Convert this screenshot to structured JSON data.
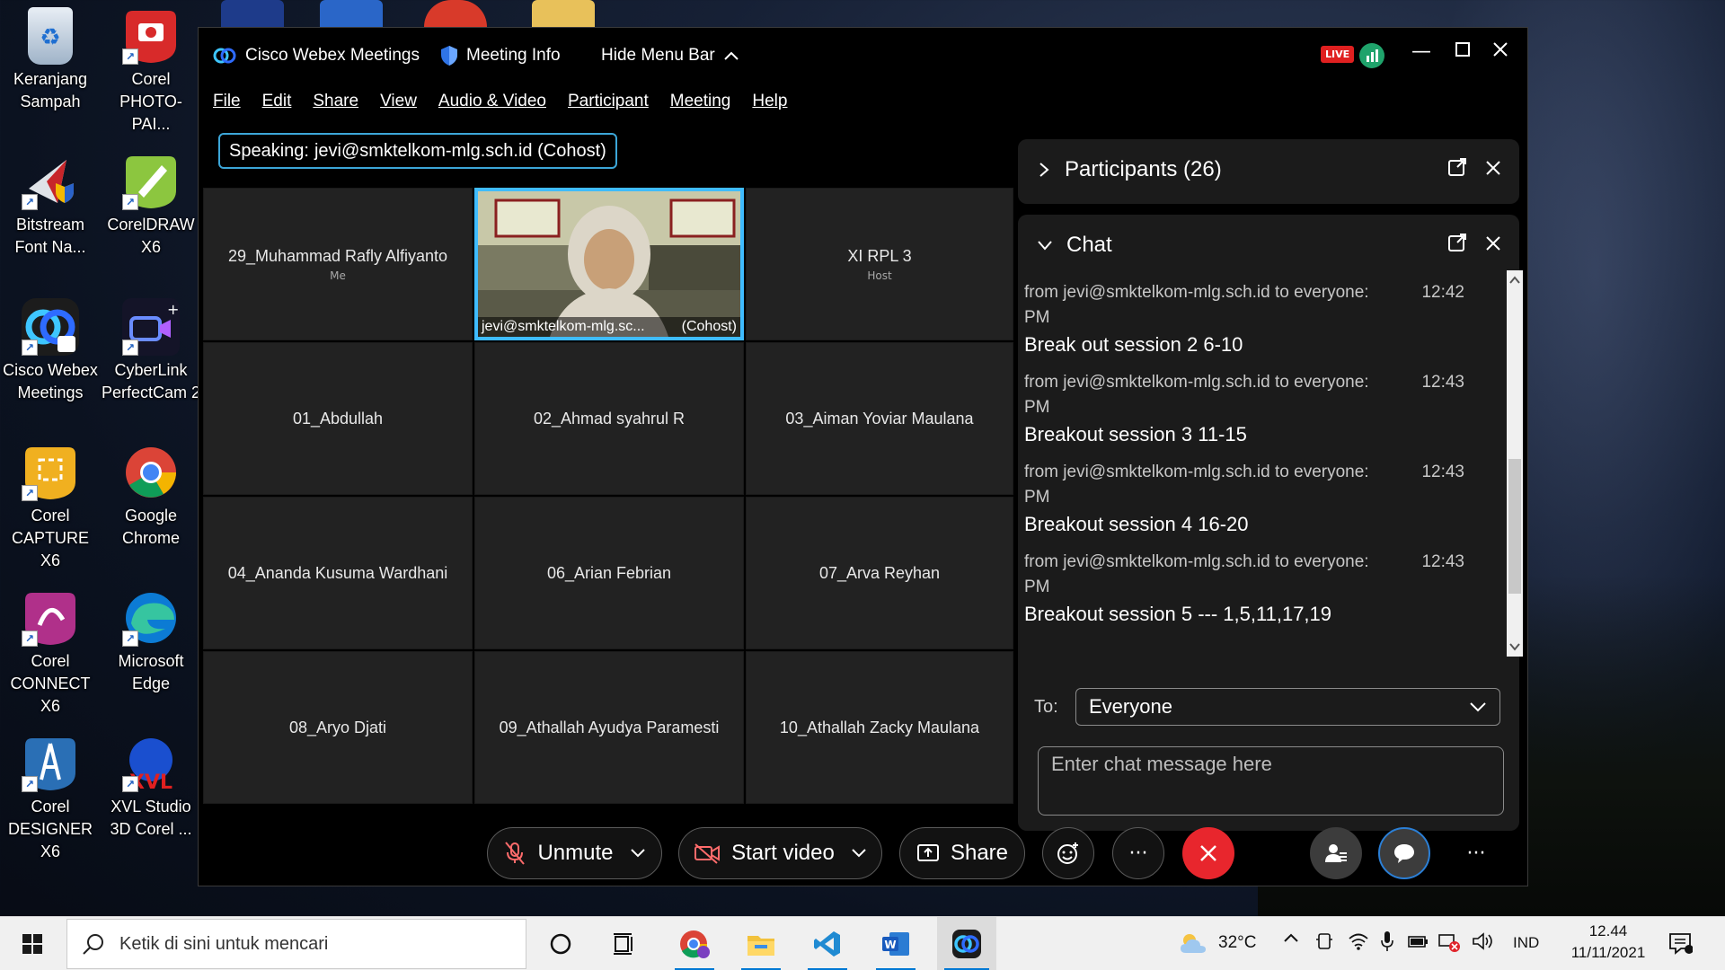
{
  "desktop": {
    "icons": [
      {
        "label": "Keranjang\nSampah"
      },
      {
        "label": "Corel\nPHOTO-PAI..."
      },
      {
        "label": "Bitstream\nFont Na..."
      },
      {
        "label": "CorelDRAW\nX6"
      },
      {
        "label": "Cisco Webex\nMeetings"
      },
      {
        "label": "CyberLink\nPerfectCam 2"
      },
      {
        "label": "Corel\nCAPTURE X6"
      },
      {
        "label": "Google\nChrome"
      },
      {
        "label": "Corel\nCONNECT X6"
      },
      {
        "label": "Microsoft\nEdge"
      },
      {
        "label": "Corel\nDESIGNER X6"
      },
      {
        "label": "XVL Studio\n3D Corel ..."
      }
    ]
  },
  "window": {
    "app_title": "Cisco Webex Meetings",
    "meeting_info": "Meeting Info",
    "hide_menu": "Hide Menu Bar",
    "live_badge": "LIVE",
    "menu": [
      "File",
      "Edit",
      "Share",
      "View",
      "Audio & Video",
      "Participant",
      "Meeting",
      "Help"
    ],
    "speaking_label": "Speaking:",
    "speaking_name": "jevi@smktelkom-mlg.sch.id (Cohost)"
  },
  "grid": {
    "tiles": [
      {
        "name": "29_Muhammad Rafly Alfiyanto",
        "role": "Me"
      },
      {
        "name": "jevi@smktelkom-mlg.sc...",
        "role": "(Cohost)"
      },
      {
        "name": "XI RPL 3",
        "role": "Host"
      },
      {
        "name": "01_Abdullah",
        "role": ""
      },
      {
        "name": "02_Ahmad syahrul R",
        "role": ""
      },
      {
        "name": "03_Aiman Yoviar Maulana",
        "role": ""
      },
      {
        "name": "04_Ananda Kusuma Wardhani",
        "role": ""
      },
      {
        "name": "06_Arian Febrian",
        "role": ""
      },
      {
        "name": "07_Arva Reyhan",
        "role": ""
      },
      {
        "name": "08_Aryo Djati",
        "role": ""
      },
      {
        "name": "09_Athallah Ayudya Paramesti",
        "role": ""
      },
      {
        "name": "10_Athallah Zacky Maulana",
        "role": ""
      }
    ]
  },
  "participants": {
    "title": "Participants (26)"
  },
  "chat": {
    "title": "Chat",
    "messages": [
      {
        "from": "from jevi@smktelkom-mlg.sch.id to everyone:",
        "time": "12:42",
        "ampm": "PM",
        "text": "Break out session 2 6-10"
      },
      {
        "from": "from jevi@smktelkom-mlg.sch.id to everyone:",
        "time": "12:43",
        "ampm": "PM",
        "text": "Breakout session 3  11-15"
      },
      {
        "from": "from jevi@smktelkom-mlg.sch.id to everyone:",
        "time": "12:43",
        "ampm": "PM",
        "text": "Breakout session 4  16-20"
      },
      {
        "from": "from jevi@smktelkom-mlg.sch.id to everyone:",
        "time": "12:43",
        "ampm": "PM",
        "text": "Breakout session 5 --- 1,5,11,17,19"
      }
    ],
    "to_label": "To:",
    "to_value": "Everyone",
    "input_placeholder": "Enter chat message here"
  },
  "controls": {
    "unmute": "Unmute",
    "start_video": "Start video",
    "share": "Share",
    "more": "···"
  },
  "taskbar": {
    "search_placeholder": "Ketik di sini untuk mencari",
    "weather": "32°C",
    "language": "IND",
    "time": "12.44",
    "date": "11/11/2021"
  },
  "colors": {
    "accent": "#3fbcff",
    "end_call": "#e8262d",
    "chat_active": "#3c3c3c"
  }
}
